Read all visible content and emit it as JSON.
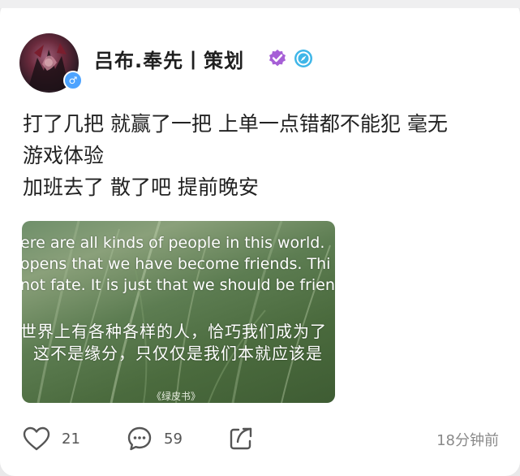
{
  "author": {
    "name": "吕布.奉先丨策划",
    "gender_icon": "male-icon",
    "verified_icon": "verified-badge-icon",
    "extra_icon": "compass-icon"
  },
  "post": {
    "lines": [
      "打了几把 就赢了一把 上单一点错都不能犯 毫无",
      "游戏体验",
      "加班去了 散了吧 提前晚安"
    ],
    "image": {
      "en_lines": [
        "ere are all kinds of people in this world.",
        "opens that we have become friends. Thi",
        "not fate. It is just that we should be frien"
      ],
      "zh_lines": [
        "世界上有各种各样的人，恰巧我们成为了",
        "这不是缘分，只仅仅是我们本就应该是"
      ],
      "caption": "《绿皮书》"
    }
  },
  "actions": {
    "like_count": "21",
    "comment_count": "59",
    "share_icon": "share-icon"
  },
  "timestamp": "18分钟前",
  "colors": {
    "verified": "#a65fd6",
    "compass": "#3fb6e8",
    "gender": "#4da3ff"
  }
}
